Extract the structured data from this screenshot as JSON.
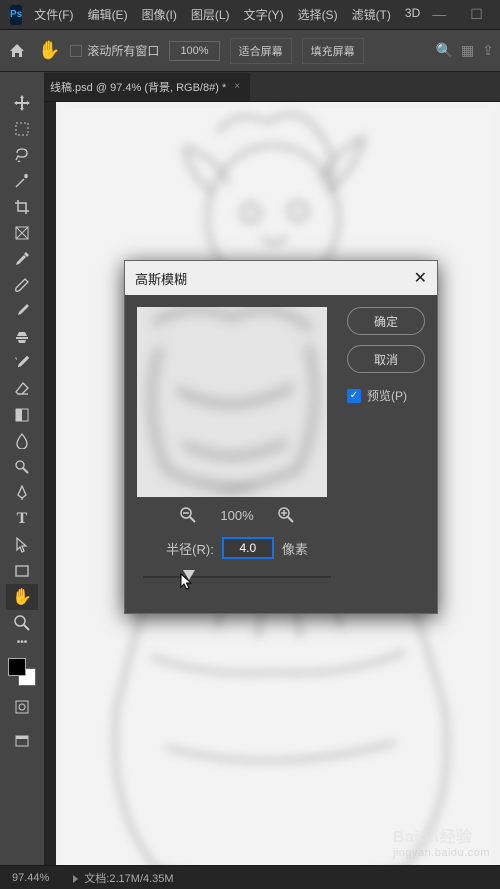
{
  "titlebar": {
    "logo": "Ps"
  },
  "menu": {
    "file": "文件(F)",
    "edit": "编辑(E)",
    "image": "图像(I)",
    "layer": "图层(L)",
    "type": "文字(Y)",
    "select": "选择(S)",
    "filter": "滤镜(T)",
    "view3d": "3D"
  },
  "options": {
    "scroll_all_windows": "滚动所有窗口",
    "zoom_percent": "100%",
    "fit_screen": "适合屏幕",
    "fill_screen": "填充屏幕"
  },
  "tab": {
    "label": "线稿.psd @ 97.4% (背景, RGB/8#) *",
    "close": "×"
  },
  "dialog": {
    "title": "高斯模糊",
    "ok": "确定",
    "cancel": "取消",
    "preview": "预览(P)",
    "zoom": "100%",
    "radius_label": "半径(R):",
    "radius_value": "4.0",
    "radius_unit": "像素"
  },
  "status": {
    "zoom": "97.44%",
    "doc": "文档:2.17M/4.35M"
  },
  "watermark": {
    "main": "Baidli经验",
    "sub": "jingyan.baidu.com"
  }
}
